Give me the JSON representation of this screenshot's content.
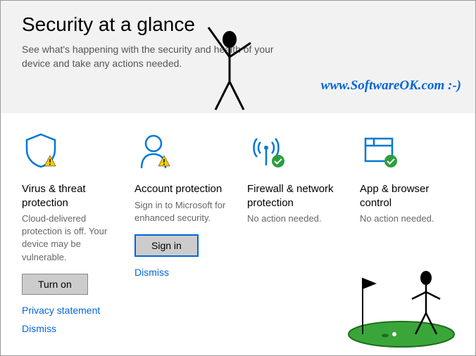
{
  "header": {
    "title": "Security at a glance",
    "subtitle": "See what's happening with the security and health of your device and take any actions needed."
  },
  "watermark": "www.SoftwareOK.com :-)",
  "tiles": [
    {
      "title": "Virus & threat protection",
      "desc": "Cloud-delivered protection is off. Your device may be vulnerable.",
      "action": "Turn on",
      "link1": "Privacy statement",
      "link2": "Dismiss"
    },
    {
      "title": "Account protection",
      "desc": "Sign in to Microsoft for enhanced security.",
      "action": "Sign in",
      "link1": "Dismiss"
    },
    {
      "title": "Firewall & network protection",
      "desc": "No action needed."
    },
    {
      "title": "App & browser control",
      "desc": "No action needed."
    }
  ]
}
